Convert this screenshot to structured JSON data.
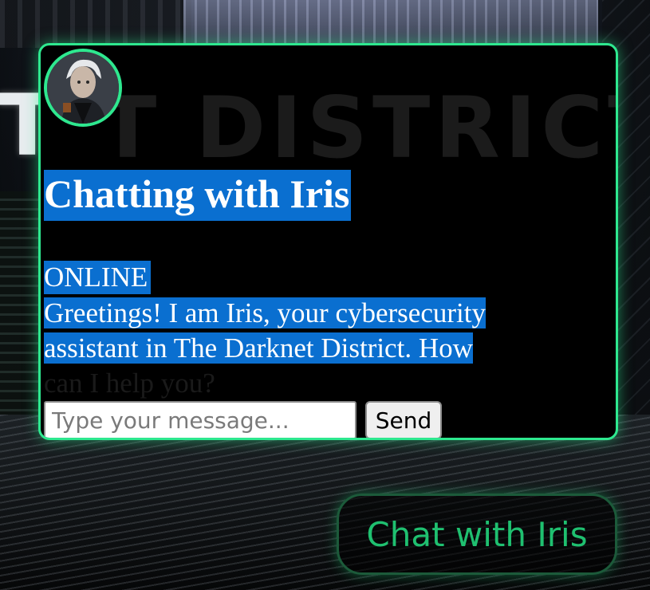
{
  "background": {
    "title_text": "THE DARKNET DISTRICT",
    "visible_title_fragment": "T DISTRICT"
  },
  "chat": {
    "heading": "Chatting with Iris",
    "status": "ONLINE",
    "message_lines": [
      "Greetings! I am Iris, your cybersecurity",
      "assistant in The Darknet District. How",
      "can I help you?"
    ],
    "input_placeholder": "Type your message...",
    "input_value": "",
    "send_label": "Send",
    "avatar_icon": "iris-avatar"
  },
  "launcher": {
    "label": "Chat with Iris"
  },
  "colors": {
    "accent": "#2ee88f",
    "selection": "#0a6fd0",
    "launcher_text": "#1fc070"
  }
}
